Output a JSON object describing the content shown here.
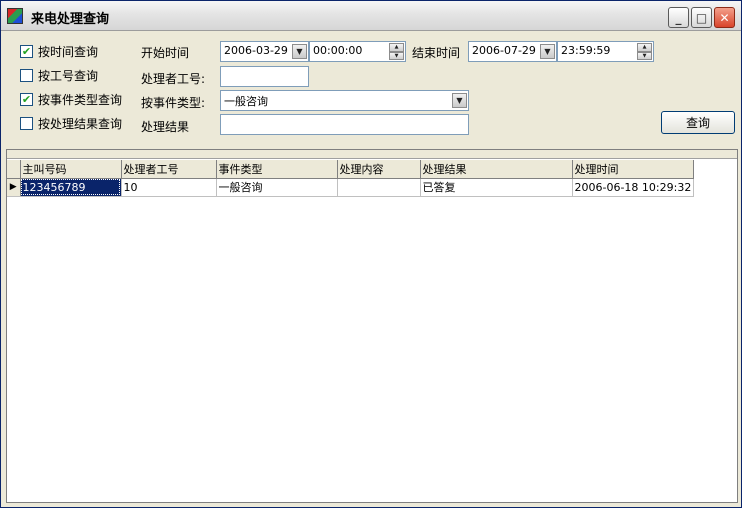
{
  "window": {
    "title": "来电处理查询"
  },
  "filters": {
    "time": {
      "checked": true,
      "label": "按时间查询",
      "start_label": "开始时间",
      "start_date": "2006-03-29",
      "start_time": "00:00:00",
      "end_label": "结束时间",
      "end_date": "2006-07-29",
      "end_time": "23:59:59"
    },
    "operator": {
      "checked": false,
      "label": "按工号查询",
      "field_label": "处理者工号:",
      "value": ""
    },
    "event_type": {
      "checked": true,
      "label": "按事件类型查询",
      "field_label": "按事件类型:",
      "value": "一般咨询"
    },
    "result": {
      "checked": false,
      "label": "按处理结果查询",
      "field_label": "处理结果",
      "value": ""
    }
  },
  "query_button": "查询",
  "grid": {
    "columns": [
      "主叫号码",
      "处理者工号",
      "事件类型",
      "处理内容",
      "处理结果",
      "处理时间"
    ],
    "rows": [
      [
        "123456789",
        "10",
        "一般咨询",
        "",
        "已答复",
        "2006-06-18 10:29:32"
      ]
    ]
  },
  "colors": {
    "selection": "#0a246a",
    "check": "#21a121",
    "face": "#ece9d8"
  }
}
